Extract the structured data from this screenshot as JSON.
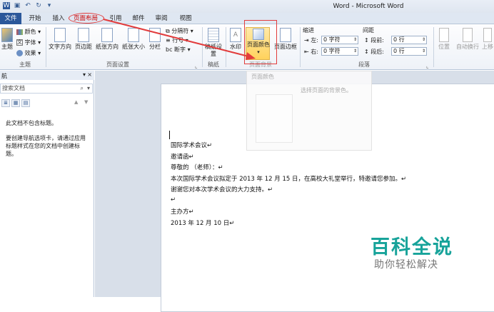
{
  "window": {
    "title": "Word - Microsoft Word"
  },
  "tabs": {
    "file": "文件",
    "home": "开始",
    "insert": "插入",
    "layout": "页面布局",
    "references": "引用",
    "mailings": "邮件",
    "review": "审阅",
    "view": "视图"
  },
  "ribbon": {
    "theme": {
      "themes": "主题",
      "colors": "颜色",
      "fonts": "字体",
      "effects": "效果",
      "group": "主题"
    },
    "page_setup": {
      "text_direction": "文字方向",
      "margins": "页边距",
      "orientation": "纸张方向",
      "size": "纸张大小",
      "columns": "分栏",
      "breaks": "分隔符",
      "line_numbers": "行号",
      "hyphenation": "断字",
      "group": "页面设置"
    },
    "manuscript": {
      "settings": "稿纸设置",
      "group": "稿纸"
    },
    "page_background": {
      "watermark": "水印",
      "page_color": "页面颜色",
      "page_borders": "页面边框",
      "group": "页面背景"
    },
    "paragraph": {
      "indent": "缩进",
      "spacing": "间距",
      "left_label": "左:",
      "left_value": "0 字符",
      "right_label": "右:",
      "right_value": "0 字符",
      "before_label": "段前:",
      "before_value": "0 行",
      "after_label": "段后:",
      "after_value": "0 行",
      "group": "段落"
    },
    "arrange": {
      "position": "位置",
      "wrap": "自动换行",
      "bring_forward": "上移"
    }
  },
  "page_color_menu": {
    "title": "页面颜色",
    "description": "选择页面的背景色。"
  },
  "nav": {
    "title": "航",
    "search_placeholder": "搜索文档",
    "msg1": "此文档不包含标题。",
    "msg2": "要创建导航选项卡，请通过应用标题样式在您的文档中创建标题。"
  },
  "document": {
    "lines": [
      "国际学术会议↵",
      "邀请函↵",
      "尊敬的            （老师）：↵",
      "本次国际学术会议拟定于 2013 年 12 月 15 日，在高校大礼堂举行，特邀请您参加。↵",
      "谢谢您对本次学术会议的大力支持。↵",
      "↵",
      "主办方↵",
      "2013 年 12 月 10 日↵"
    ]
  },
  "watermark": {
    "big": "百科全说",
    "small": "助你轻松解决"
  }
}
